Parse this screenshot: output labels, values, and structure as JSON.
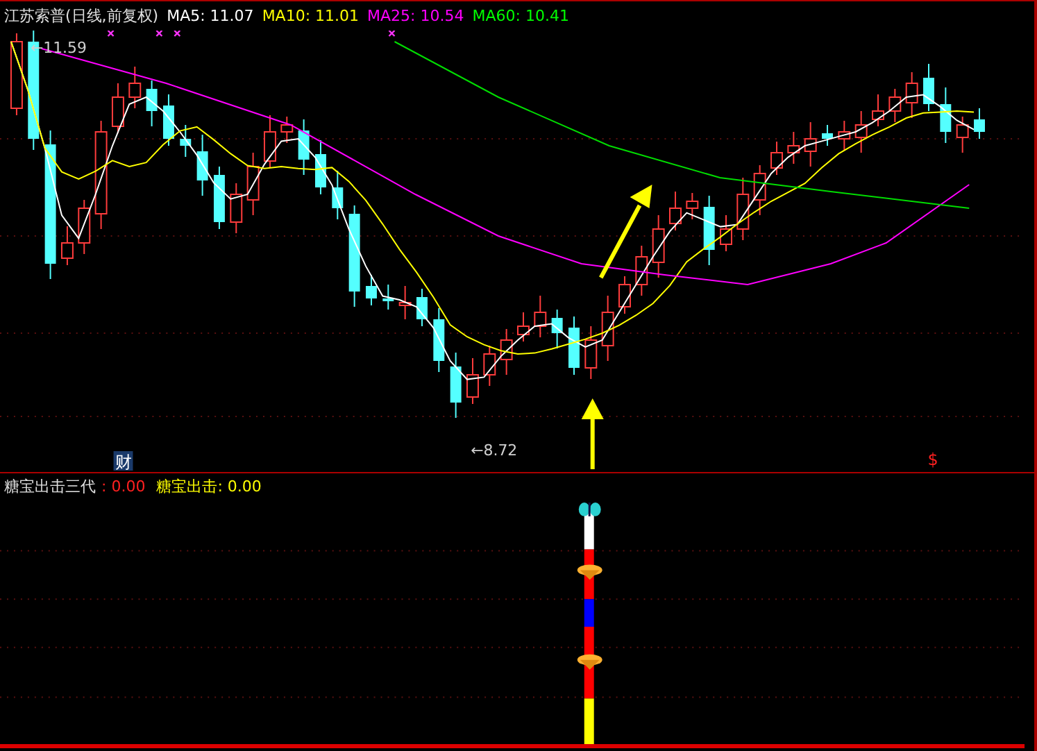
{
  "header": {
    "title": "江苏索普(日线,前复权)",
    "indicators": [
      {
        "text": "MA5: 11.07",
        "color": "#ffffff"
      },
      {
        "text": "MA10: 11.01",
        "color": "#ffff00"
      },
      {
        "text": "MA25: 10.54",
        "color": "#ff00ff"
      },
      {
        "text": "MA60: 10.41",
        "color": "#00ff00"
      }
    ]
  },
  "chart": {
    "high_label": "←11.59",
    "low_label": "←8.72",
    "finance_tag": "财",
    "dividend_tag": "$"
  },
  "lower": {
    "title": "糖宝出击三代",
    "value": ": 0.00",
    "signal": "糖宝出击: 0.00"
  }
}
